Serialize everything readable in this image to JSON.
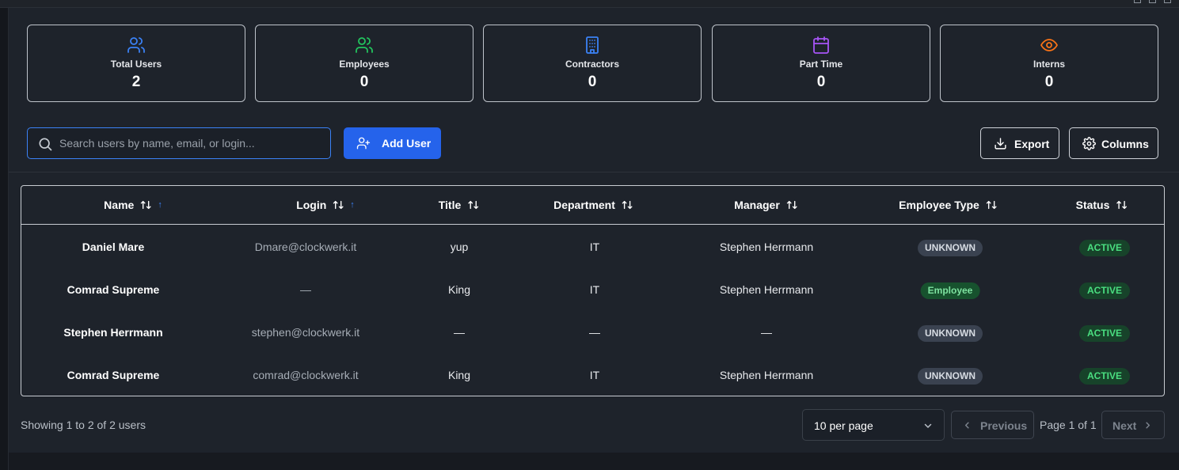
{
  "colors": {
    "accent": "#2563eb",
    "users_icon": "#3b82f6",
    "employees_icon": "#22c55e",
    "contractors_icon": "#3b82f6",
    "parttime_icon": "#a855f7",
    "interns_icon": "#f97316",
    "active_badge": "#4ade80"
  },
  "stats": [
    {
      "label": "Total Users",
      "value": "2",
      "icon": "users-icon"
    },
    {
      "label": "Employees",
      "value": "0",
      "icon": "users-icon"
    },
    {
      "label": "Contractors",
      "value": "0",
      "icon": "building-icon"
    },
    {
      "label": "Part Time",
      "value": "0",
      "icon": "calendar-icon"
    },
    {
      "label": "Interns",
      "value": "0",
      "icon": "eye-icon"
    }
  ],
  "toolbar": {
    "search_placeholder": "Search users by name, email, or login...",
    "search_value": "",
    "add_user_label": "Add User",
    "export_label": "Export",
    "columns_label": "Columns"
  },
  "table": {
    "columns": [
      "Name",
      "Login",
      "Title",
      "Department",
      "Manager",
      "Employee Type",
      "Status"
    ],
    "rows": [
      {
        "name": "Daniel Mare",
        "login": "Dmare@clockwerk.it",
        "title": "yup",
        "department": "IT",
        "manager": "Stephen Herrmann",
        "employee_type": "UNKNOWN",
        "status": "ACTIVE"
      },
      {
        "name": "Comrad Supreme",
        "login": "—",
        "title": "King",
        "department": "IT",
        "manager": "Stephen Herrmann",
        "employee_type": "Employee",
        "status": "ACTIVE"
      },
      {
        "name": "Stephen Herrmann",
        "login": "stephen@clockwerk.it",
        "title": "—",
        "department": "—",
        "manager": "—",
        "employee_type": "UNKNOWN",
        "status": "ACTIVE"
      },
      {
        "name": "Comrad Supreme",
        "login": "comrad@clockwerk.it",
        "title": "King",
        "department": "IT",
        "manager": "Stephen Herrmann",
        "employee_type": "UNKNOWN",
        "status": "ACTIVE"
      }
    ]
  },
  "footer": {
    "showing_text": "Showing 1 to 2 of 2 users",
    "per_page": "10 per page",
    "previous_label": "Previous",
    "page_info": "Page 1 of 1",
    "next_label": "Next"
  }
}
